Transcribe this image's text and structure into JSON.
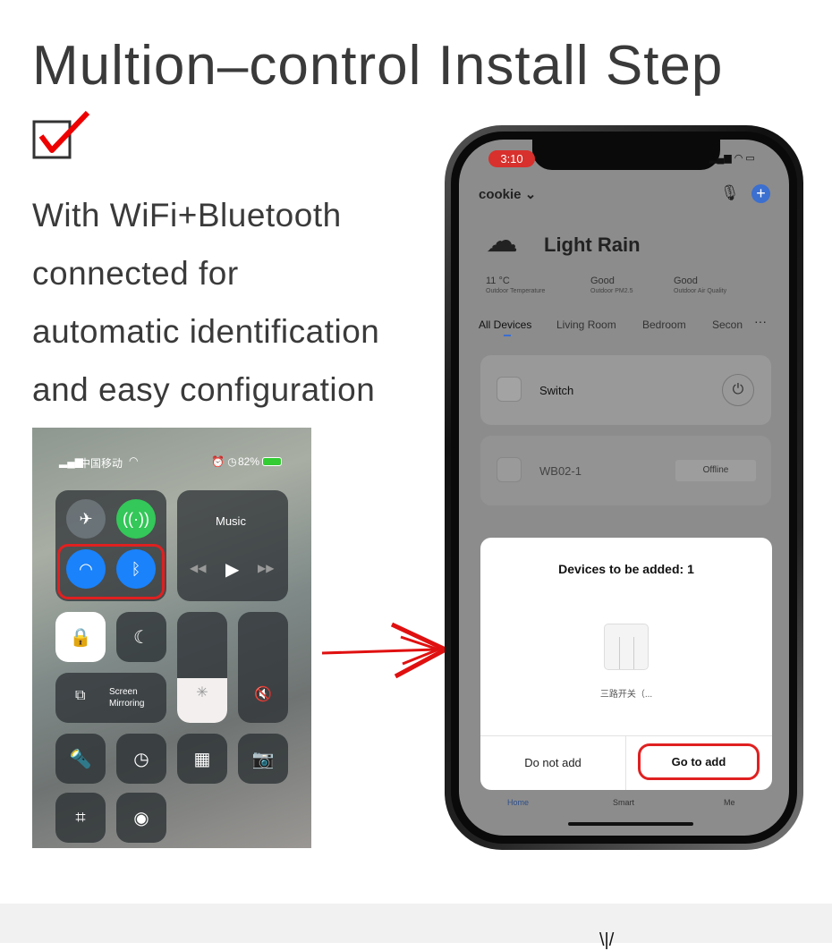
{
  "heading": {
    "title": "Multion–control Install Step",
    "description_lines": [
      "With WiFi+Bluetooth",
      "connected for",
      "automatic identification",
      "and easy configuration"
    ]
  },
  "control_center": {
    "carrier": "中国移动",
    "battery": "82%",
    "music_label": "Music",
    "screen_mirroring": "Screen Mirroring",
    "wifi_on": true,
    "bluetooth_on": true,
    "highlight_color": "#e02020"
  },
  "app": {
    "status_time": "3:10",
    "home_name": "cookie",
    "weather": {
      "condition": "Light Rain",
      "temperature": "11 °C",
      "temperature_label": "Outdoor Temperature",
      "pm25": "Good",
      "pm25_label": "Outdoor PM2.5",
      "air_quality": "Good",
      "air_quality_label": "Outdoor Air Quality"
    },
    "tabs": [
      "All Devices",
      "Living Room",
      "Bedroom",
      "Secon"
    ],
    "devices": [
      {
        "name": "Switch"
      },
      {
        "name": "WB02-1",
        "status": "Offline"
      }
    ],
    "bottom_nav": [
      "Home",
      "Smart",
      "Me"
    ],
    "modal": {
      "title": "Devices to be added: 1",
      "device_name": "三路开关（...",
      "cancel": "Do not add",
      "confirm": "Go to add"
    },
    "accent": "#3b6fd0"
  }
}
